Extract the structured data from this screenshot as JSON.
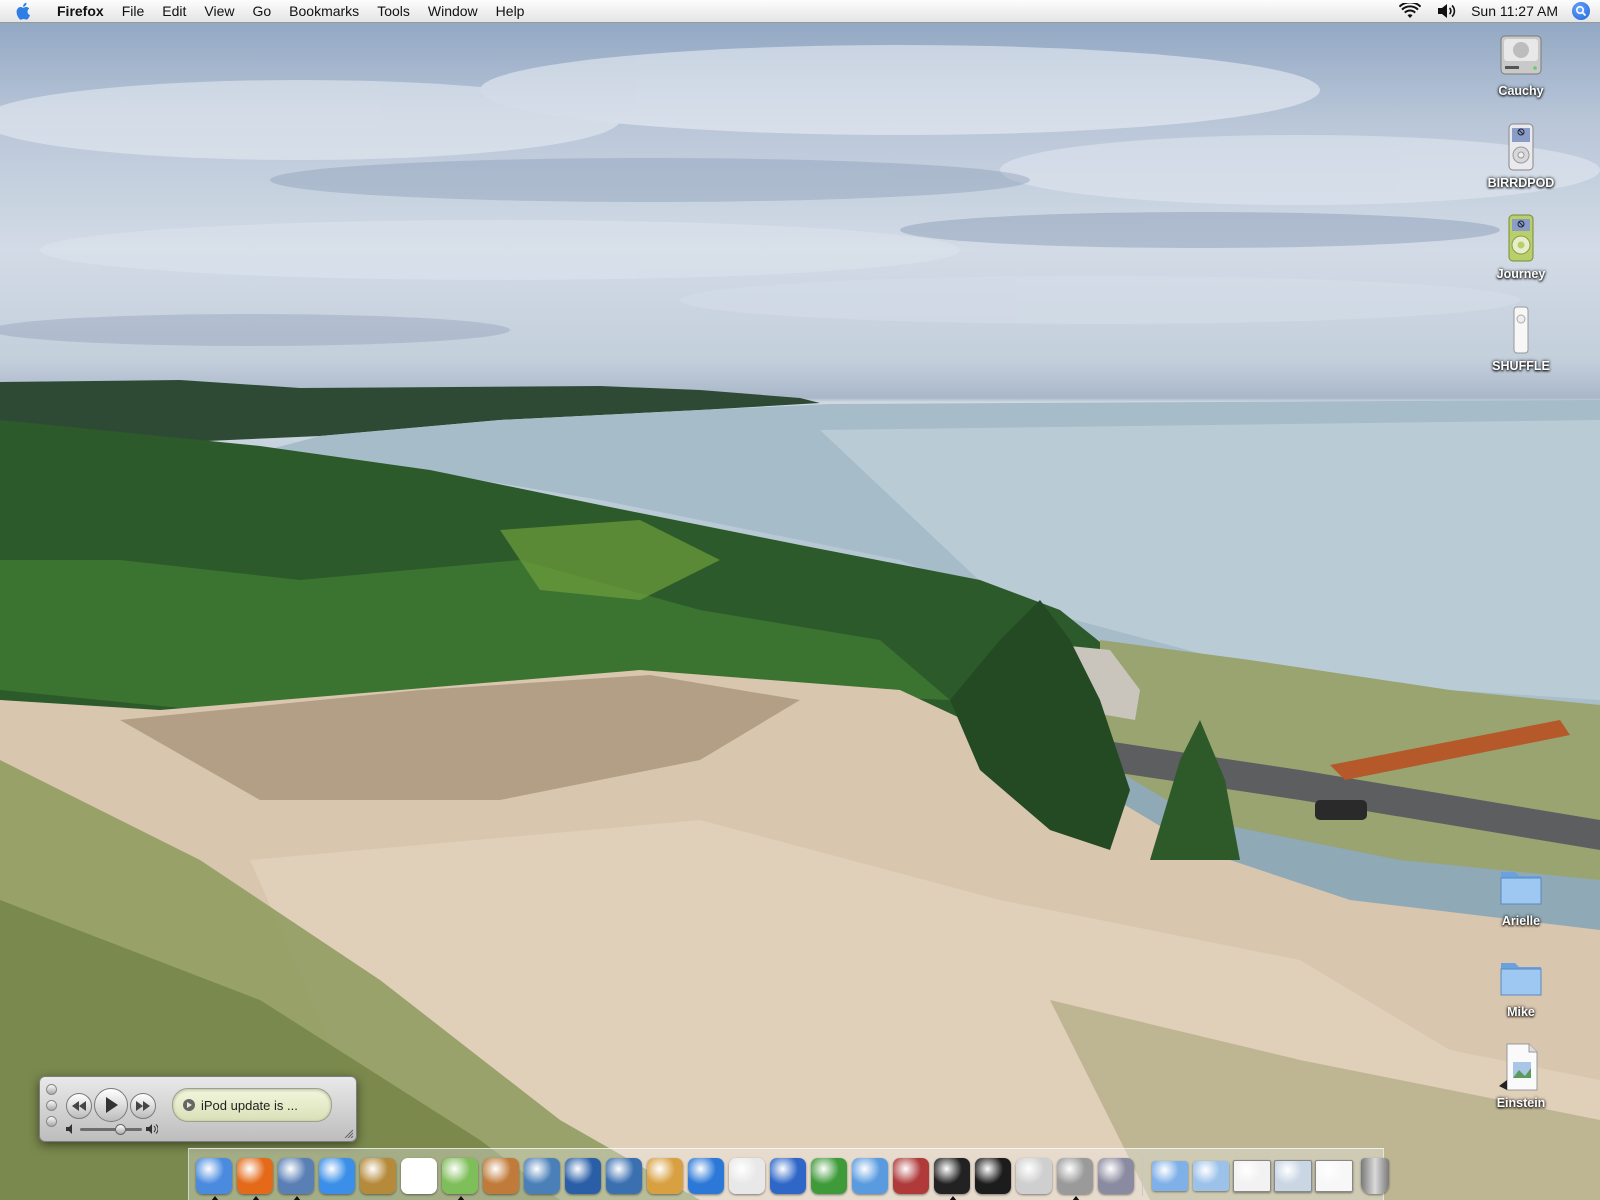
{
  "menubar": {
    "apple_icon": "apple-logo-icon",
    "app_name": "Firefox",
    "menus": [
      "File",
      "Edit",
      "View",
      "Go",
      "Bookmarks",
      "Tools",
      "Window",
      "Help"
    ],
    "status_icons": [
      "wifi-icon",
      "volume-icon"
    ],
    "clock": "Sun 11:27 AM",
    "spotlight_icon": "spotlight-icon"
  },
  "desktop_icons": [
    {
      "name": "Cauchy",
      "icon": "hard-drive-icon"
    },
    {
      "name": "BIRRDPOD",
      "icon": "ipod-silver-icon"
    },
    {
      "name": "Journey",
      "icon": "ipod-mini-green-icon"
    },
    {
      "name": "SHUFFLE",
      "icon": "ipod-shuffle-icon"
    },
    {
      "name": "Arielle",
      "icon": "folder-icon"
    },
    {
      "name": "Mike",
      "icon": "folder-icon"
    },
    {
      "name": "Einstein",
      "icon": "document-alias-icon"
    }
  ],
  "miniplayer": {
    "status_text": "iPod update is ...",
    "volume_level": 0.65
  },
  "dock": {
    "apps": [
      {
        "icon": "finder-icon",
        "color": "#4a8be0",
        "running": true
      },
      {
        "icon": "firefox-icon",
        "color": "#e46a1a",
        "running": true
      },
      {
        "icon": "mail-icon",
        "color": "#5a7fb5",
        "running": true
      },
      {
        "icon": "ichat-icon",
        "color": "#3b8fe8",
        "running": false
      },
      {
        "icon": "address-book-icon",
        "color": "#b58a3a",
        "running": false
      },
      {
        "icon": "ical-icon",
        "color": "#ffffff",
        "running": false
      },
      {
        "icon": "itunes-icon",
        "color": "#7fbf5a",
        "running": true
      },
      {
        "icon": "iphoto-icon",
        "color": "#c07a3a",
        "running": false
      },
      {
        "icon": "preview-icon",
        "color": "#4a7fb8",
        "running": false
      },
      {
        "icon": "imovie-icon",
        "color": "#2a5fa8",
        "running": false
      },
      {
        "icon": "idvd-icon",
        "color": "#3a6fb0",
        "running": false
      },
      {
        "icon": "garageband-icon",
        "color": "#d8a040",
        "running": false
      },
      {
        "icon": "quicktime-icon",
        "color": "#2b78d8",
        "running": false
      },
      {
        "icon": "textedit-icon",
        "color": "#e8e8e8",
        "running": false
      },
      {
        "icon": "word-icon",
        "color": "#2f67c8",
        "running": false
      },
      {
        "icon": "mathematica-icon",
        "color": "#3f9b3a",
        "running": false
      },
      {
        "icon": "safari-icon",
        "color": "#5a9be0",
        "running": false
      },
      {
        "icon": "utility-tool-icon",
        "color": "#b03a3a",
        "running": false
      },
      {
        "icon": "terminal-icon",
        "color": "#222222",
        "running": true
      },
      {
        "icon": "activity-monitor-icon",
        "color": "#1c1c1c",
        "running": false
      },
      {
        "icon": "system-profiler-icon",
        "color": "#cfcfcf",
        "running": false
      },
      {
        "icon": "x11-icon",
        "color": "#9a9a9a",
        "running": true
      },
      {
        "icon": "system-preferences-icon",
        "color": "#8a8aa0",
        "running": false
      }
    ],
    "docs": [
      {
        "icon": "applications-folder-icon",
        "color": "#7fb0e8"
      },
      {
        "icon": "documents-folder-icon",
        "color": "#9cc2ea"
      },
      {
        "icon": "minimized-window-icon",
        "color": "#f2f2f2"
      },
      {
        "icon": "minimized-photo-window-icon",
        "color": "#c9d6e4"
      },
      {
        "icon": "minimized-firefox-window-icon",
        "color": "#f7f7f7"
      },
      {
        "icon": "trash-icon",
        "color": "#9a9a9a"
      }
    ]
  }
}
